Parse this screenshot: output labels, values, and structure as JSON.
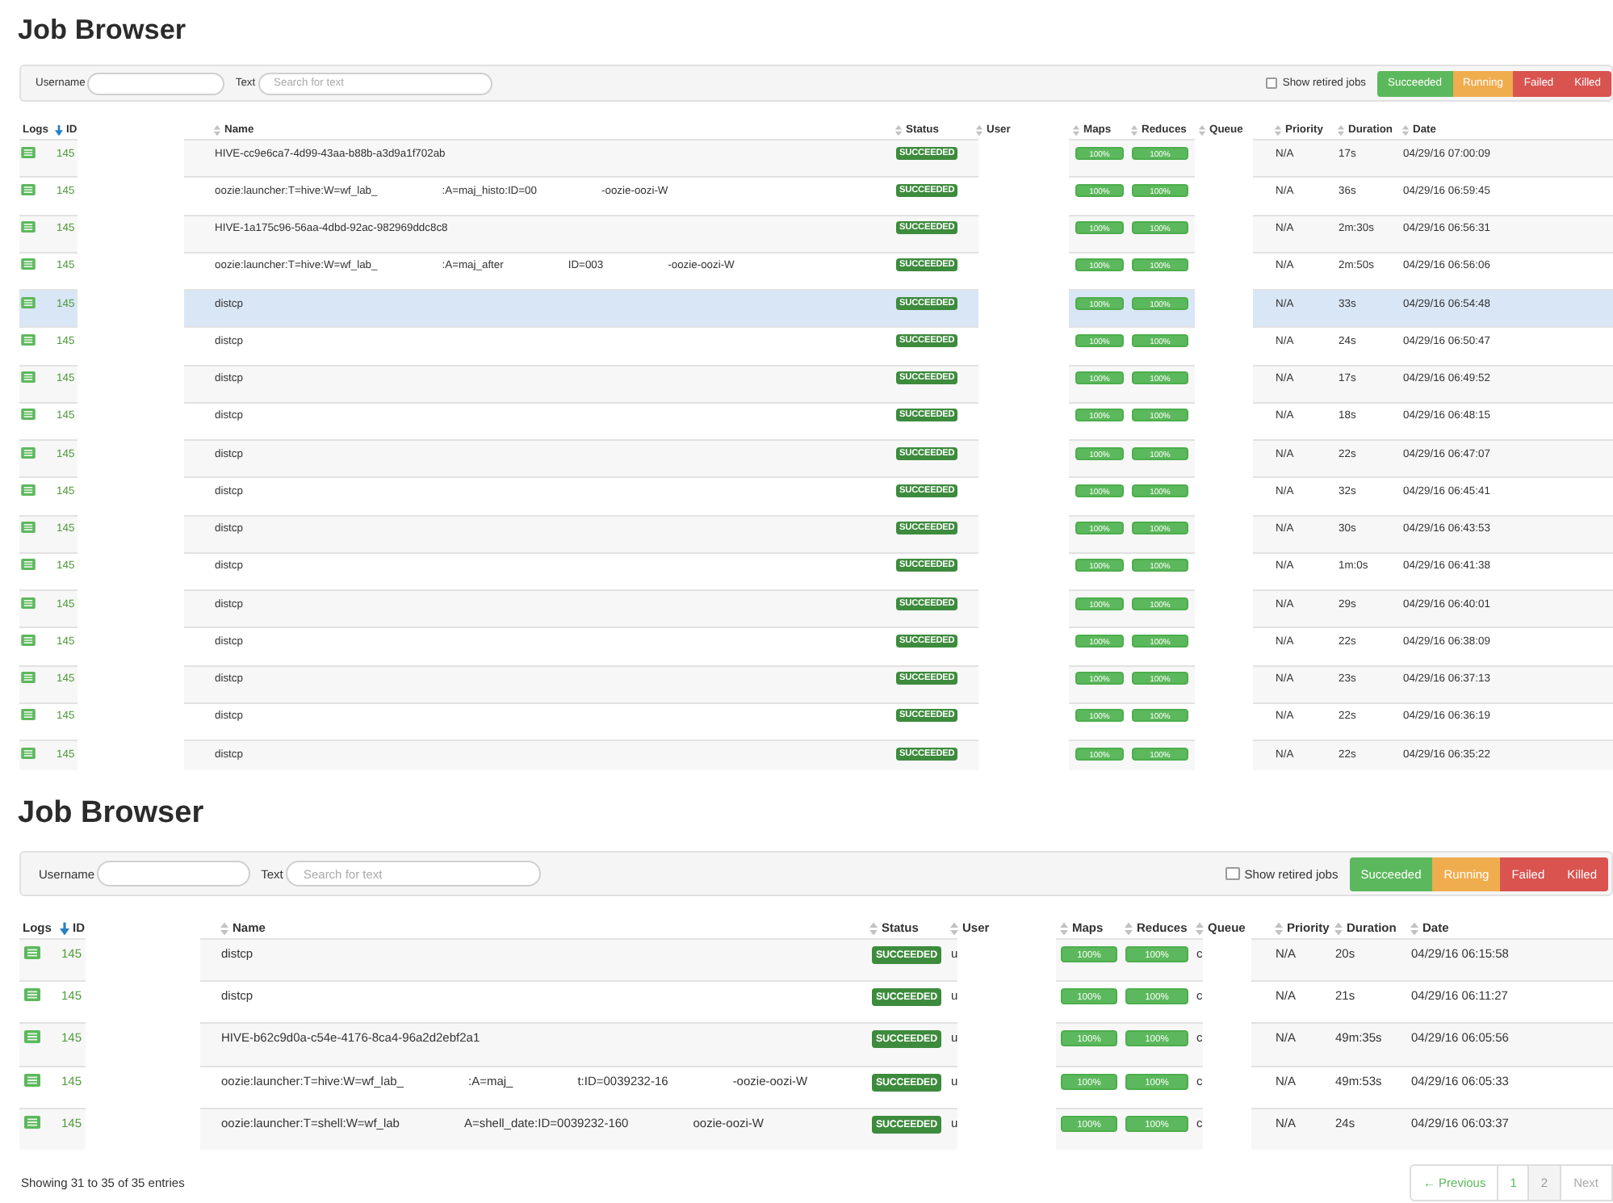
{
  "panels": [
    {
      "title": "Job Browser",
      "filters": {
        "username": {
          "label": "Username"
        },
        "text": {
          "label": "Text",
          "placeholder": "Search for text"
        },
        "retired": {
          "label": "Show retired jobs",
          "checked": false
        },
        "states": [
          {
            "label": "Succeeded",
            "color": "#5cb85c"
          },
          {
            "label": "Running",
            "color": "#f0ad4e"
          },
          {
            "label": "Failed",
            "color": "#d9534f"
          },
          {
            "label": "Killed",
            "color": "#d9534f"
          }
        ]
      },
      "table": {
        "columns": [
          {
            "label": "Logs",
            "sortable": false
          },
          {
            "label": "ID",
            "sortable": true,
            "sorted": true
          },
          {
            "label": "Name",
            "sortable": true,
            "sorted": false
          },
          {
            "label": "Status",
            "sortable": true,
            "sorted": false
          },
          {
            "label": "User",
            "sortable": true,
            "sorted": false
          },
          {
            "label": "Maps",
            "sortable": true,
            "sorted": false
          },
          {
            "label": "Reduces",
            "sortable": true,
            "sorted": false
          },
          {
            "label": "Queue",
            "sortable": true,
            "sorted": false
          },
          {
            "label": "Priority",
            "sortable": true,
            "sorted": false
          },
          {
            "label": "Duration",
            "sortable": true,
            "sorted": false
          },
          {
            "label": "Date",
            "sortable": true,
            "sorted": false
          }
        ],
        "rows": [
          {
            "id": "145",
            "name": [
              "HIVE-cc9e6ca7-4d99-43aa-b88b-a3d9a1f702ab"
            ],
            "status": {
              "label": "SUCCEEDED",
              "kind": "succeeded"
            },
            "maps": {
              "label": "100%",
              "level": 1
            },
            "reduces": {
              "label": "100%",
              "level": 1
            },
            "priority": "N/A",
            "duration": "17s",
            "date": "04/29/16 07:00:09",
            "selected": false
          },
          {
            "id": "145",
            "name": [
              "oozie:launcher:T=hive:W=wf_lab_",
              ":A=maj_histo:ID=00",
              "-oozie-oozi-W"
            ],
            "status": {
              "label": "SUCCEEDED",
              "kind": "succeeded"
            },
            "maps": {
              "label": "100%",
              "level": 1
            },
            "reduces": {
              "label": "100%",
              "level": 1
            },
            "priority": "N/A",
            "duration": "36s",
            "date": "04/29/16 06:59:45",
            "selected": false
          },
          {
            "id": "145",
            "name": [
              "HIVE-1a175c96-56aa-4dbd-92ac-982969ddc8c8"
            ],
            "status": {
              "label": "SUCCEEDED",
              "kind": "succeeded"
            },
            "maps": {
              "label": "100%",
              "level": 1
            },
            "reduces": {
              "label": "100%",
              "level": 1
            },
            "priority": "N/A",
            "duration": "2m:30s",
            "date": "04/29/16 06:56:31",
            "selected": false
          },
          {
            "id": "145",
            "name": [
              "oozie:launcher:T=hive:W=wf_lab_",
              ":A=maj_after",
              "ID=003",
              "-oozie-oozi-W"
            ],
            "status": {
              "label": "SUCCEEDED",
              "kind": "succeeded"
            },
            "maps": {
              "label": "100%",
              "level": 1
            },
            "reduces": {
              "label": "100%",
              "level": 1
            },
            "priority": "N/A",
            "duration": "2m:50s",
            "date": "04/29/16 06:56:06",
            "selected": false
          },
          {
            "id": "145",
            "name": [
              "distcp"
            ],
            "status": {
              "label": "SUCCEEDED",
              "kind": "succeeded"
            },
            "maps": {
              "label": "100%",
              "level": 1
            },
            "reduces": {
              "label": "100%",
              "level": 1
            },
            "priority": "N/A",
            "duration": "33s",
            "date": "04/29/16 06:54:48",
            "selected": true
          },
          {
            "id": "145",
            "name": [
              "distcp"
            ],
            "status": {
              "label": "SUCCEEDED",
              "kind": "succeeded"
            },
            "maps": {
              "label": "100%",
              "level": 1
            },
            "reduces": {
              "label": "100%",
              "level": 1
            },
            "priority": "N/A",
            "duration": "24s",
            "date": "04/29/16 06:50:47",
            "selected": false
          },
          {
            "id": "145",
            "name": [
              "distcp"
            ],
            "status": {
              "label": "SUCCEEDED",
              "kind": "succeeded"
            },
            "maps": {
              "label": "100%",
              "level": 1
            },
            "reduces": {
              "label": "100%",
              "level": 1
            },
            "priority": "N/A",
            "duration": "17s",
            "date": "04/29/16 06:49:52",
            "selected": false
          },
          {
            "id": "145",
            "name": [
              "distcp"
            ],
            "status": {
              "label": "SUCCEEDED",
              "kind": "succeeded"
            },
            "maps": {
              "label": "100%",
              "level": 1
            },
            "reduces": {
              "label": "100%",
              "level": 1
            },
            "priority": "N/A",
            "duration": "18s",
            "date": "04/29/16 06:48:15",
            "selected": false
          },
          {
            "id": "145",
            "name": [
              "distcp"
            ],
            "status": {
              "label": "SUCCEEDED",
              "kind": "succeeded"
            },
            "maps": {
              "label": "100%",
              "level": 1
            },
            "reduces": {
              "label": "100%",
              "level": 1
            },
            "priority": "N/A",
            "duration": "22s",
            "date": "04/29/16 06:47:07",
            "selected": false
          },
          {
            "id": "145",
            "name": [
              "distcp"
            ],
            "status": {
              "label": "SUCCEEDED",
              "kind": "succeeded"
            },
            "maps": {
              "label": "100%",
              "level": 1
            },
            "reduces": {
              "label": "100%",
              "level": 1
            },
            "priority": "N/A",
            "duration": "32s",
            "date": "04/29/16 06:45:41",
            "selected": false
          },
          {
            "id": "145",
            "name": [
              "distcp"
            ],
            "status": {
              "label": "SUCCEEDED",
              "kind": "succeeded"
            },
            "maps": {
              "label": "100%",
              "level": 1
            },
            "reduces": {
              "label": "100%",
              "level": 1
            },
            "priority": "N/A",
            "duration": "30s",
            "date": "04/29/16 06:43:53",
            "selected": false
          },
          {
            "id": "145",
            "name": [
              "distcp"
            ],
            "status": {
              "label": "SUCCEEDED",
              "kind": "succeeded"
            },
            "maps": {
              "label": "100%",
              "level": 1
            },
            "reduces": {
              "label": "100%",
              "level": 1
            },
            "priority": "N/A",
            "duration": "1m:0s",
            "date": "04/29/16 06:41:38",
            "selected": false
          },
          {
            "id": "145",
            "name": [
              "distcp"
            ],
            "status": {
              "label": "SUCCEEDED",
              "kind": "succeeded"
            },
            "maps": {
              "label": "100%",
              "level": 1
            },
            "reduces": {
              "label": "100%",
              "level": 1
            },
            "priority": "N/A",
            "duration": "29s",
            "date": "04/29/16 06:40:01",
            "selected": false
          },
          {
            "id": "145",
            "name": [
              "distcp"
            ],
            "status": {
              "label": "SUCCEEDED",
              "kind": "succeeded"
            },
            "maps": {
              "label": "100%",
              "level": 1
            },
            "reduces": {
              "label": "100%",
              "level": 1
            },
            "priority": "N/A",
            "duration": "22s",
            "date": "04/29/16 06:38:09",
            "selected": false
          },
          {
            "id": "145",
            "name": [
              "distcp"
            ],
            "status": {
              "label": "SUCCEEDED",
              "kind": "succeeded"
            },
            "maps": {
              "label": "100%",
              "level": 1
            },
            "reduces": {
              "label": "100%",
              "level": 1
            },
            "priority": "N/A",
            "duration": "23s",
            "date": "04/29/16 06:37:13",
            "selected": false
          },
          {
            "id": "145",
            "name": [
              "distcp"
            ],
            "status": {
              "label": "SUCCEEDED",
              "kind": "succeeded"
            },
            "maps": {
              "label": "100%",
              "level": 1
            },
            "reduces": {
              "label": "100%",
              "level": 1
            },
            "priority": "N/A",
            "duration": "22s",
            "date": "04/29/16 06:36:19",
            "selected": false
          },
          {
            "id": "145",
            "name": [
              "distcp"
            ],
            "status": {
              "label": "SUCCEEDED",
              "kind": "succeeded"
            },
            "maps": {
              "label": "100%",
              "level": 1
            },
            "reduces": {
              "label": "100%",
              "level": 1
            },
            "priority": "N/A",
            "duration": "22s",
            "date": "04/29/16 06:35:22",
            "selected": false
          }
        ]
      }
    },
    {
      "title": "Job Browser",
      "filters": {
        "username": {
          "label": "Username"
        },
        "text": {
          "label": "Text",
          "placeholder": "Search for text"
        },
        "retired": {
          "label": "Show retired jobs",
          "checked": false
        },
        "states": [
          {
            "label": "Succeeded",
            "color": "#5cb85c"
          },
          {
            "label": "Running",
            "color": "#f0ad4e"
          },
          {
            "label": "Failed",
            "color": "#d9534f"
          },
          {
            "label": "Killed",
            "color": "#d9534f"
          }
        ]
      },
      "table": {
        "columns": [
          {
            "label": "Logs",
            "sortable": false
          },
          {
            "label": "ID",
            "sortable": true,
            "sorted": true
          },
          {
            "label": "Name",
            "sortable": true,
            "sorted": false
          },
          {
            "label": "Status",
            "sortable": true,
            "sorted": false
          },
          {
            "label": "User",
            "sortable": true,
            "sorted": false
          },
          {
            "label": "Maps",
            "sortable": true,
            "sorted": false
          },
          {
            "label": "Reduces",
            "sortable": true,
            "sorted": false
          },
          {
            "label": "Queue",
            "sortable": true,
            "sorted": false
          },
          {
            "label": "Priority",
            "sortable": true,
            "sorted": false
          },
          {
            "label": "Duration",
            "sortable": true,
            "sorted": false
          },
          {
            "label": "Date",
            "sortable": true,
            "sorted": false
          }
        ],
        "rows": [
          {
            "id": "145",
            "name": [
              "distcp"
            ],
            "status": {
              "label": "SUCCEEDED",
              "kind": "succeeded"
            },
            "user": "u",
            "maps": {
              "label": "100%",
              "level": 1
            },
            "reduces": {
              "label": "100%",
              "level": 1
            },
            "queue": "c",
            "priority": "N/A",
            "duration": "20s",
            "date": "04/29/16 06:15:58",
            "selected": false
          },
          {
            "id": "145",
            "name": [
              "distcp"
            ],
            "status": {
              "label": "SUCCEEDED",
              "kind": "succeeded"
            },
            "user": "u",
            "maps": {
              "label": "100%",
              "level": 1
            },
            "reduces": {
              "label": "100%",
              "level": 1
            },
            "queue": "c",
            "priority": "N/A",
            "duration": "21s",
            "date": "04/29/16 06:11:27",
            "selected": false
          },
          {
            "id": "145",
            "name": [
              "HIVE-b62c9d0a-c54e-4176-8ca4-96a2d2ebf2a1"
            ],
            "status": {
              "label": "SUCCEEDED",
              "kind": "succeeded"
            },
            "user": "u",
            "maps": {
              "label": "100%",
              "level": 1
            },
            "reduces": {
              "label": "100%",
              "level": 1
            },
            "queue": "c",
            "priority": "N/A",
            "duration": "49m:35s",
            "date": "04/29/16 06:05:56",
            "selected": false
          },
          {
            "id": "145",
            "name": [
              "oozie:launcher:T=hive:W=wf_lab_",
              ":A=maj_",
              "t:ID=0039232-16",
              "-oozie-oozi-W"
            ],
            "status": {
              "label": "SUCCEEDED",
              "kind": "succeeded"
            },
            "user": "u",
            "maps": {
              "label": "100%",
              "level": 1
            },
            "reduces": {
              "label": "100%",
              "level": 1
            },
            "queue": "c",
            "priority": "N/A",
            "duration": "49m:53s",
            "date": "04/29/16 06:05:33",
            "selected": false
          },
          {
            "id": "145",
            "name": [
              "oozie:launcher:T=shell:W=wf_lab",
              "A=shell_date:ID=0039232-160",
              "oozie-oozi-W"
            ],
            "status": {
              "label": "SUCCEEDED",
              "kind": "succeeded"
            },
            "user": "u",
            "maps": {
              "label": "100%",
              "level": 1
            },
            "reduces": {
              "label": "100%",
              "level": 1
            },
            "queue": "c",
            "priority": "N/A",
            "duration": "24s",
            "date": "04/29/16 06:03:37",
            "selected": false
          }
        ]
      },
      "footer": {
        "info": "Showing 31 to 35 of 35 entries",
        "pagination": [
          {
            "label": "← Previous",
            "kind": "previous",
            "selected": false,
            "disabled": false
          },
          {
            "label": "1",
            "kind": "page",
            "selected": false,
            "disabled": false
          },
          {
            "label": "2",
            "kind": "page",
            "selected": true,
            "disabled": false
          },
          {
            "label": "Next",
            "kind": "next",
            "selected": false,
            "disabled": true
          }
        ]
      }
    }
  ]
}
